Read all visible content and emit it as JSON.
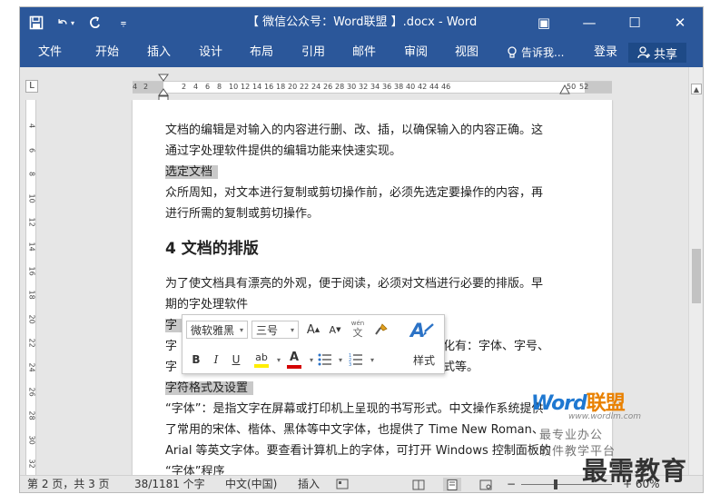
{
  "window": {
    "title": "【 微信公众号：Word联盟 】.docx - Word",
    "minimize_glyph": "—",
    "maximize_glyph": "☐",
    "close_glyph": "✕",
    "ribbon_display_glyph": "▣"
  },
  "qat": {
    "save_icon": "save-icon",
    "undo_icon": "undo-icon",
    "redo_icon": "redo-icon",
    "customize_glyph": "⩦"
  },
  "ribbon": {
    "tabs": [
      "文件",
      "开始",
      "插入",
      "设计",
      "布局",
      "引用",
      "邮件",
      "审阅",
      "视图"
    ],
    "tell_me": "告诉我...",
    "login": "登录",
    "share": "共享"
  },
  "ruler": {
    "marks": [
      "4",
      "2",
      "2",
      "4",
      "6",
      "8",
      "10",
      "12",
      "14",
      "16",
      "18",
      "20",
      "22",
      "24",
      "26",
      "28",
      "30",
      "32",
      "34",
      "36",
      "38",
      "40",
      "42",
      "44",
      "46",
      "50",
      "52"
    ],
    "tab_selector": "L"
  },
  "vruler": {
    "marks": [
      "4",
      "6",
      "8",
      "10",
      "12",
      "14",
      "16",
      "18",
      "20",
      "22",
      "24",
      "26",
      "28",
      "30",
      "32"
    ]
  },
  "document": {
    "p1_line1": "文档的编辑是对输入的内容进行删、改、插，以确保输入的内容正确。这",
    "p1_line2": "通过字处理软件提供的编辑功能来快速实现。",
    "sub1": "选定文档",
    "p2_line1": "众所周知，对文本进行复制或剪切操作前，必须先选定要操作的内容，再",
    "p2_line2": "进行所需的复制或剪切操作。",
    "heading": "4 文档的排版",
    "p3_line1": "为了使文档具有漂亮的外观，便于阅读，必须对文档进行必要的排版。早",
    "p3_line2": "期的字处理软件",
    "sub2": "字",
    "p4_start": "字",
    "p4_tail": "的格式化有：字体、字号、",
    "p5_start": "字",
    "p5_tail": "中文版式等。",
    "sub3": "字符格式及设置",
    "p6_line1": "“字体”：是指文字在屏幕或打印机上呈现的书写形式。中文操作系统提供",
    "p6_line2": "了常用的宋体、楷体、黑体等中文字体，也提供了 Time New Roman、",
    "p6_line3": "Arial 等英文字体。要查看计算机上的字体，可打开 Windows 控制面板的",
    "p6_line4": "“字体”程序"
  },
  "minitoolbar": {
    "font_name": "微软雅黑",
    "font_size": "三号",
    "grow_font": "A",
    "shrink_font": "A",
    "phonetic": "wén",
    "phonetic_char": "文",
    "bold": "B",
    "italic": "I",
    "underline": "U",
    "highlight": "ab",
    "font_color": "A",
    "styles": "样式"
  },
  "status": {
    "page": "第 2 页，共 3 页",
    "words": "38/1181 个字",
    "language": "中文(中国)",
    "insert": "插入",
    "zoom_hint": "+ 60%"
  },
  "watermark": {
    "word": "Word",
    "lianmeng": "联盟",
    "site": "www.wordlm.com",
    "line1": "最专业办公",
    "line2": "软件教学平台",
    "big": "最需教育"
  },
  "colors": {
    "title_bar": "#2b579a",
    "highlight_gray": "#c9c9c9",
    "watermark_blue": "#1f78d1",
    "watermark_orange": "#e98100",
    "font_color_red": "#d40000",
    "highlight_yellow": "#ffee00"
  }
}
